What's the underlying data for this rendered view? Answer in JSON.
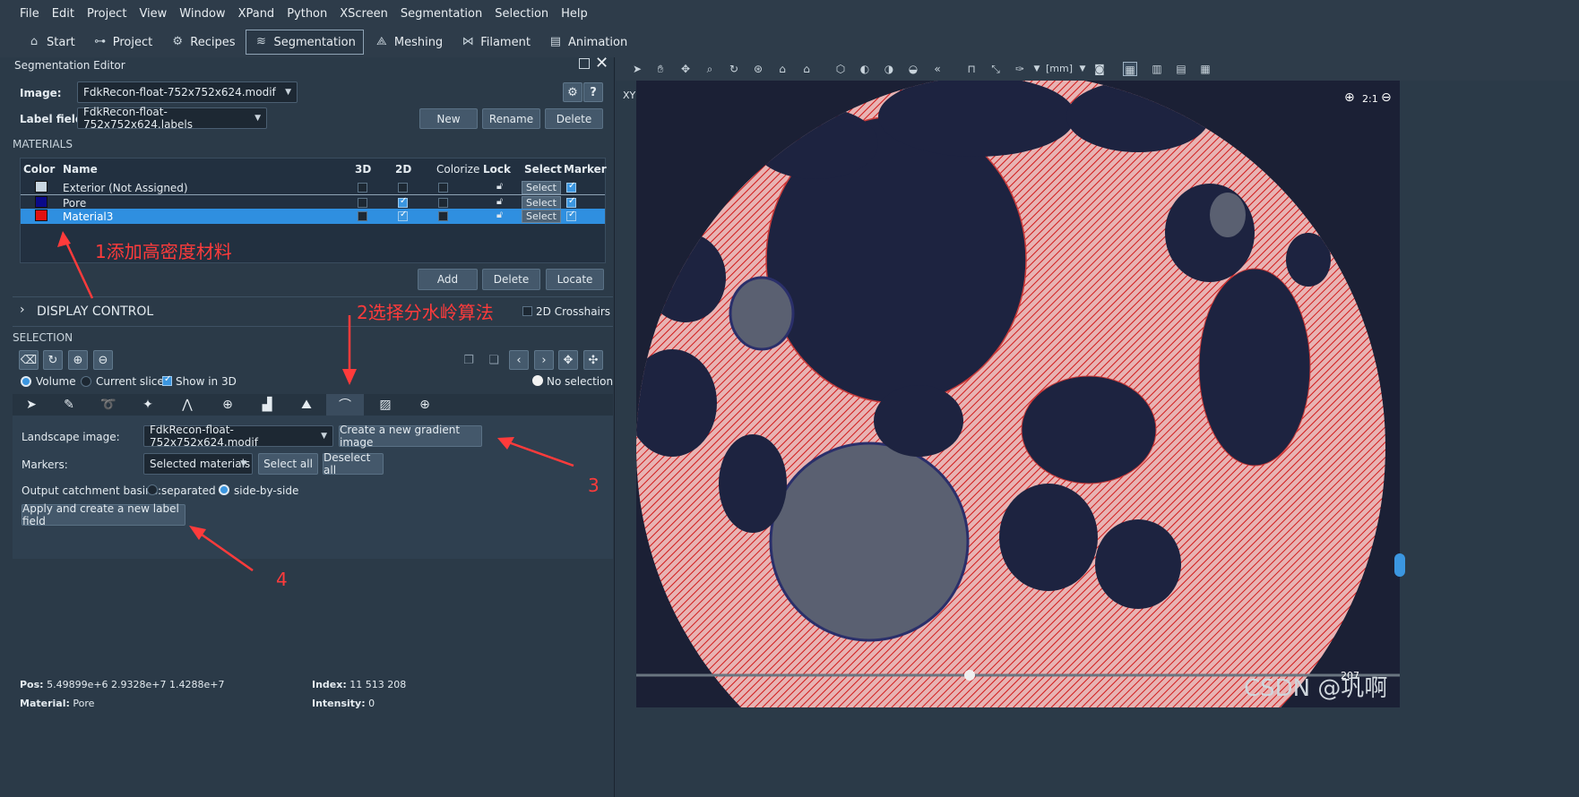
{
  "menu": [
    "File",
    "Edit",
    "Project",
    "View",
    "Window",
    "XPand",
    "Python",
    "XScreen",
    "Segmentation",
    "Selection",
    "Help"
  ],
  "workroom_tabs": [
    {
      "label": "Start",
      "icon": "home-icon"
    },
    {
      "label": "Project",
      "icon": "project-icon"
    },
    {
      "label": "Recipes",
      "icon": "recipes-icon"
    },
    {
      "label": "Segmentation",
      "icon": "segmentation-icon",
      "active": true
    },
    {
      "label": "Meshing",
      "icon": "meshing-icon"
    },
    {
      "label": "Filament",
      "icon": "filament-icon"
    },
    {
      "label": "Animation",
      "icon": "animation-icon"
    }
  ],
  "panel": {
    "title": "Segmentation Editor",
    "image_label": "Image:",
    "image_value": "FdkRecon-float-752x752x624.modif",
    "labelfield_label": "Label field:",
    "labelfield_value": "FdkRecon-float-752x752x624.labels",
    "new": "New",
    "rename": "Rename",
    "delete": "Delete"
  },
  "materials": {
    "section": "MATERIALS",
    "headers": {
      "color": "Color",
      "name": "Name",
      "d3": "3D",
      "d2": "2D",
      "colorize": "Colorize",
      "lock": "Lock",
      "select": "Select",
      "marker": "Marker"
    },
    "rows": [
      {
        "name": "Exterior (Not Assigned)",
        "color": "#c9d6e0",
        "d3": false,
        "d2": false,
        "colorize": false,
        "select": "Select",
        "marker": true
      },
      {
        "name": "Pore",
        "color": "#0a0a8a",
        "d3": false,
        "d2": true,
        "colorize": false,
        "select": "Select",
        "marker": true
      },
      {
        "name": "Material3",
        "color": "#e01010",
        "d3": false,
        "d2": true,
        "colorize": false,
        "select": "Select",
        "marker": true,
        "selected": true
      }
    ],
    "add": "Add",
    "delete": "Delete",
    "locate": "Locate"
  },
  "display_control": {
    "label": "DISPLAY CONTROL",
    "crosshairs": "2D Crosshairs"
  },
  "selection": {
    "section": "SELECTION",
    "volume": "Volume",
    "current_slice": "Current slice",
    "show3d": "Show in 3D",
    "no_selection": "No selection"
  },
  "watershed": {
    "landscape_label": "Landscape image:",
    "landscape_value": "FdkRecon-float-752x752x624.modif",
    "create_gradient": "Create a new gradient image",
    "markers_label": "Markers:",
    "markers_value": "Selected materials",
    "select_all": "Select all",
    "deselect_all": "Deselect all",
    "output_label": "Output catchment basins:",
    "separated": "separated",
    "side_by_side": "side-by-side",
    "apply": "Apply and create a new label field"
  },
  "annotations": {
    "a1": "1添加高密度材料",
    "a2": "2选择分水岭算法",
    "a3": "3",
    "a4": "4"
  },
  "status": {
    "pos_label": "Pos:",
    "pos_value": "5.49899e+6 2.9328e+7 1.4288e+7",
    "index_label": "Index:",
    "index_value": "11 513 208",
    "material_label": "Material:",
    "material_value": "Pore",
    "intensity_label": "Intensity:",
    "intensity_value": "0"
  },
  "viewer": {
    "view_label": "XY",
    "units": "[mm]",
    "zoom": "2:1",
    "slice_value": "207"
  },
  "watermark": "CSDN @巩啊"
}
